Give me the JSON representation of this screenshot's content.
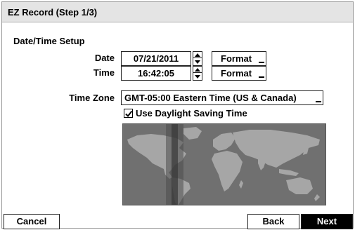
{
  "window": {
    "title": "EZ Record (Step 1/3)"
  },
  "section": {
    "title": "Date/Time Setup"
  },
  "date": {
    "label": "Date",
    "value": "07/21/2011",
    "format_label": "Format"
  },
  "time": {
    "label": "Time",
    "value": "16:42:05",
    "format_label": "Format"
  },
  "timezone": {
    "label": "Time Zone",
    "value": "GMT-05:00  Eastern Time (US & Canada)"
  },
  "dst": {
    "label": "Use Daylight Saving Time",
    "checked": true
  },
  "buttons": {
    "cancel": "Cancel",
    "back": "Back",
    "next": "Next"
  },
  "colors": {
    "map_ocean": "#707070",
    "map_land": "#a6a6a6",
    "timezone_band": "#3a3a3a",
    "selected_button": "#000000"
  }
}
